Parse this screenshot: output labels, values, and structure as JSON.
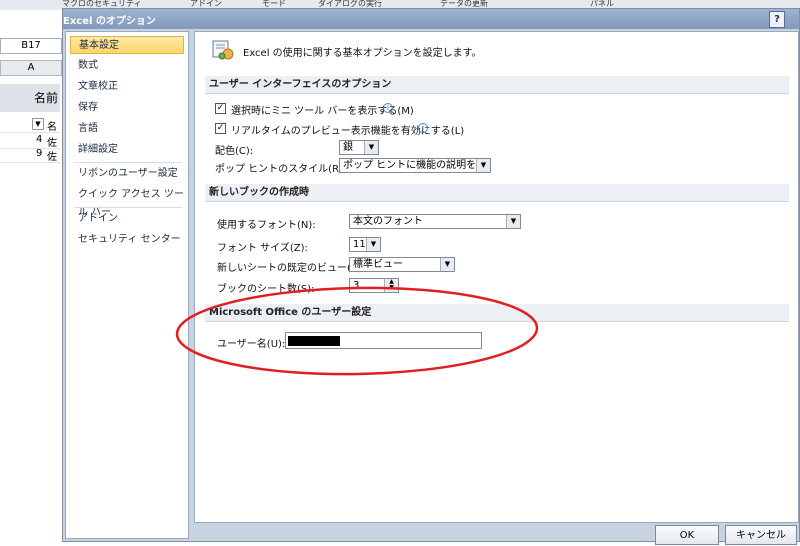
{
  "background": {
    "ribbon_items": [
      "マクロのセキュリティ",
      "アドイン",
      "モード",
      "ダイアログの実行",
      "データの更新",
      "パネル"
    ],
    "cell_ref": "B17",
    "column": "A",
    "name_header": "名前",
    "rows": [
      {
        "num": "",
        "name": "名"
      },
      {
        "num": "4",
        "name": "佐"
      },
      {
        "num": "9",
        "name": "佐"
      }
    ]
  },
  "dialog": {
    "title": "Excel のオプション",
    "help": "?",
    "nav": [
      "基本設定",
      "数式",
      "文章校正",
      "保存",
      "言語",
      "詳細設定",
      "リボンのユーザー設定",
      "クイック アクセス ツール バー",
      "アドイン",
      "セキュリティ センター"
    ],
    "intro": "Excel の使用に関する基本オプションを設定します。",
    "section1": {
      "title": "ユーザー インターフェイスのオプション",
      "minibar": "選択時にミニ ツール バーを表示する(M)",
      "livepreview": "リアルタイムのプレビュー表示機能を有効にする(L)",
      "color_label": "配色(C):",
      "color_value": "銀",
      "tip_label": "ポップ ヒントのスタイル(R):",
      "tip_value": "ポップ ヒントに機能の説明を表示する"
    },
    "section2": {
      "title": "新しいブックの作成時",
      "font_label": "使用するフォント(N):",
      "font_value": "本文のフォント",
      "size_label": "フォント サイズ(Z):",
      "size_value": "11",
      "view_label": "新しいシートの既定のビュー(V):",
      "view_value": "標準ビュー",
      "sheets_label": "ブックのシート数(S):",
      "sheets_value": "3"
    },
    "section3": {
      "title": "Microsoft Office のユーザー設定",
      "user_label": "ユーザー名(U):",
      "user_value": ""
    },
    "ok": "OK",
    "cancel": "キャンセル"
  },
  "annotation_color": "#e02020"
}
